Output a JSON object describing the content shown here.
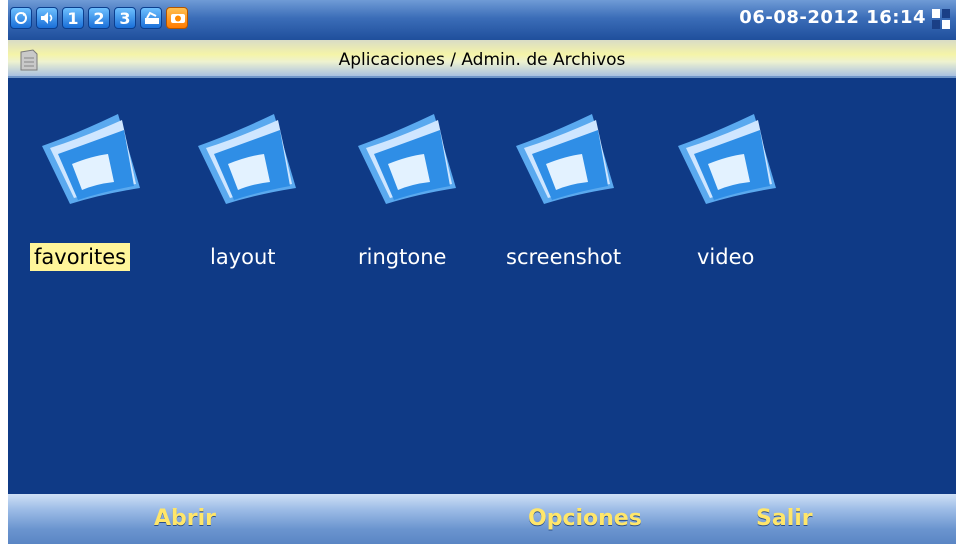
{
  "status_bar": {
    "icons": [
      "sync-icon",
      "speaker-icon",
      "line-1",
      "line-2",
      "line-3",
      "phone-hook-icon",
      "camera-off-icon"
    ],
    "line_labels": [
      "1",
      "2",
      "3"
    ],
    "datetime": "06-08-2012 16:14"
  },
  "title_bar": {
    "title": "Aplicaciones / Admin. de Archivos"
  },
  "files": {
    "items": [
      {
        "label": "favorites",
        "selected": true
      },
      {
        "label": "layout",
        "selected": false
      },
      {
        "label": "ringtone",
        "selected": false
      },
      {
        "label": "screenshot",
        "selected": false
      },
      {
        "label": "video",
        "selected": false
      }
    ]
  },
  "softkeys": {
    "left": "Abrir",
    "center": "Opciones",
    "right": "Salir"
  },
  "colors": {
    "background": "#0f3a86",
    "selection": "#fff59a",
    "softkey_text": "#ffe66a"
  }
}
